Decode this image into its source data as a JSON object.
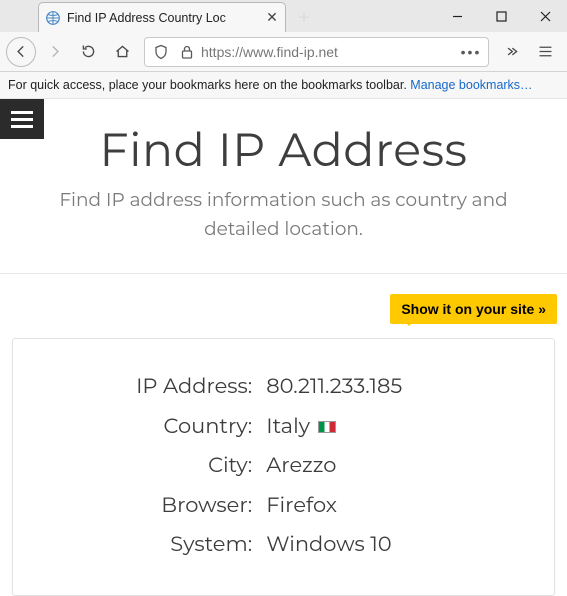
{
  "browser": {
    "tab_title": "Find IP Address Country Loc",
    "url_display": "https://www.find-ip.net",
    "bookmark_hint": "For quick access, place your bookmarks here on the bookmarks toolbar. ",
    "bookmark_link": "Manage bookmarks…"
  },
  "page": {
    "title": "Find IP Address",
    "subtitle": "Find IP address information such as country and detailed location.",
    "promo": "Show it on your site »",
    "info": {
      "ip_label": "IP Address:",
      "ip_value": "80.211.233.185",
      "country_label": "Country:",
      "country_value": "Italy",
      "city_label": "City:",
      "city_value": "Arezzo",
      "browser_label": "Browser:",
      "browser_value": "Firefox",
      "system_label": "System:",
      "system_value": "Windows 10"
    }
  }
}
